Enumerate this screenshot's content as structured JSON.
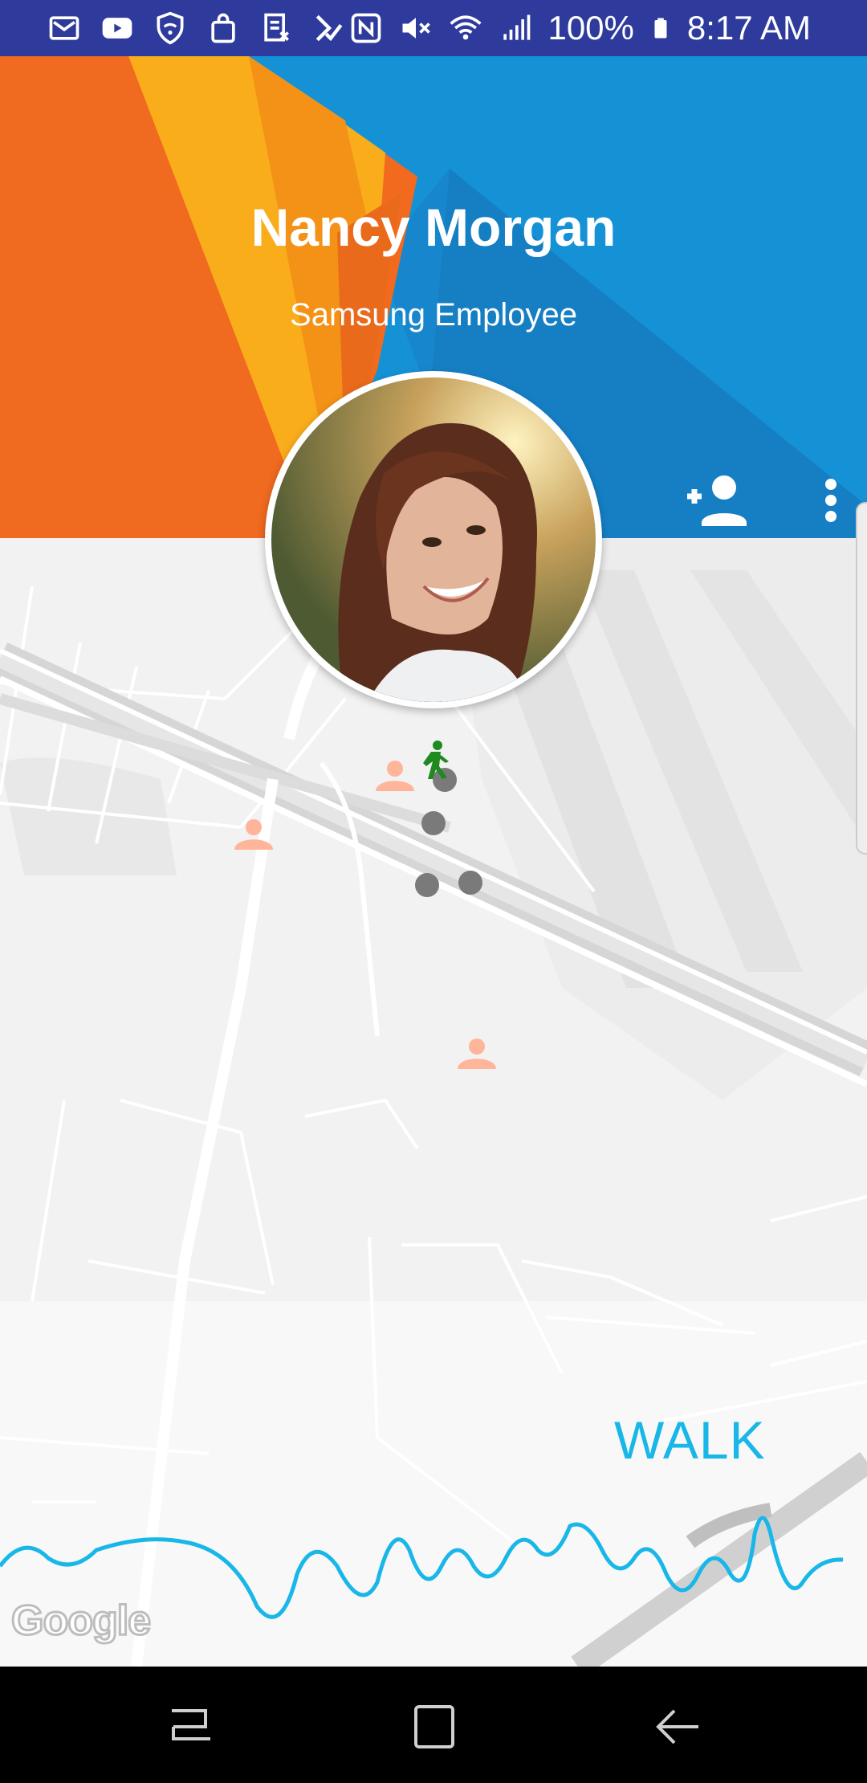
{
  "status_bar": {
    "battery": "100%",
    "time": "8:17 AM"
  },
  "profile": {
    "name": "Nancy Morgan",
    "role": "Samsung Employee"
  },
  "activity": {
    "label": "WALK"
  },
  "map": {
    "attribution": "Google"
  },
  "colors": {
    "status_bar": "#2f3b9c",
    "accent_blue": "#19b7e8",
    "header_orange": "#f26a1e",
    "header_yellow": "#f9ad1b",
    "header_blue": "#1592d6",
    "walker_green": "#1f8a1f",
    "person_marker": "#ffb59a"
  },
  "icons": {
    "add_contact": "person-add-icon",
    "more": "more-vert-icon",
    "walker": "walking-person-icon"
  }
}
